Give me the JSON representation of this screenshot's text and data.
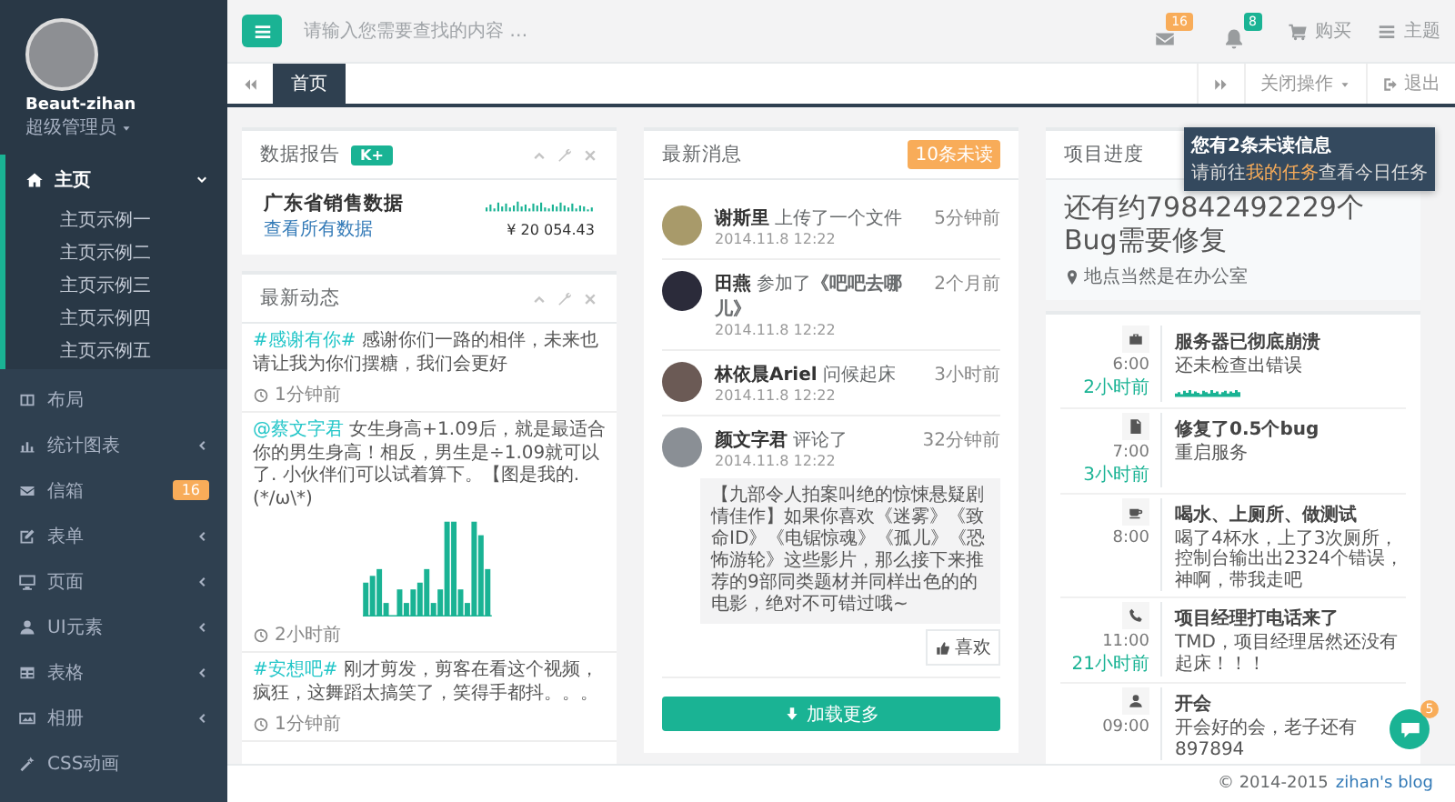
{
  "sidebar": {
    "profile": {
      "name": "Beaut-zihan",
      "role": "超级管理员"
    },
    "menu": [
      {
        "label": "主页",
        "selected": true,
        "expanded": true,
        "children": [
          {
            "label": "主页示例一"
          },
          {
            "label": "主页示例二"
          },
          {
            "label": "主页示例三"
          },
          {
            "label": "主页示例四"
          },
          {
            "label": "主页示例五"
          }
        ]
      },
      {
        "label": "布局",
        "selected": false
      },
      {
        "label": "统计图表",
        "selected": false,
        "expanded": false
      },
      {
        "label": "信箱",
        "selected": false,
        "badge": "16"
      },
      {
        "label": "表单",
        "selected": false,
        "expanded": false
      },
      {
        "label": "页面",
        "selected": false,
        "expanded": false
      },
      {
        "label": "UI元素",
        "selected": false,
        "expanded": false
      },
      {
        "label": "表格",
        "selected": false,
        "expanded": false
      },
      {
        "label": "相册",
        "selected": false,
        "expanded": false
      },
      {
        "label": "CSS动画",
        "selected": false
      }
    ]
  },
  "topbar": {
    "search": {
      "placeholder": "请输入您需要查找的内容 …"
    },
    "notifications": [
      {
        "badge": "16",
        "color": "#f8ac59"
      },
      {
        "badge": "8",
        "color": "#1ab394"
      }
    ],
    "links": [
      {
        "label": "购买"
      },
      {
        "label": "主题"
      }
    ]
  },
  "tabbar": {
    "tabs": [
      {
        "label": "首页",
        "selected": true
      }
    ],
    "close_menu": "关闭操作",
    "logout": "退出"
  },
  "data_report": {
    "title": "数据报告",
    "label": "K+",
    "heading": "广东省销售数据",
    "link": "查看所有数据",
    "amount": "¥ 20 054.43"
  },
  "feed": {
    "title": "最新动态",
    "posts": [
      {
        "kind": "text",
        "tag": "#感谢有你#",
        "text": "感谢你们一路的相伴，未来也请让我为你们摆糖，我们会更好",
        "time": "1分钟前"
      },
      {
        "kind": "chart",
        "tag": "@蔡文字君",
        "text": "女生身高+1.09后，就是最适合你的男生身高！相反，男生是÷1.09就可以了. 小伙伴们可以试着算下。【图是我的. (*/ω\\*)",
        "time": "2小时前"
      },
      {
        "kind": "text",
        "tag": "#安想吧#",
        "text": "刚才剪发，剪客在看这个视频，疯狂，这舞蹈太搞笑了，笑得手都抖。。。",
        "time": "1分钟前"
      }
    ]
  },
  "messages": {
    "title": "最新消息",
    "badge": "10条未读",
    "items": [
      {
        "name": "谢斯里",
        "action": "上传了一个文件",
        "date": "2014.11.8 12:22",
        "ago": "5分钟前"
      },
      {
        "name": "田燕",
        "action": "参加了**《吧吧去哪儿》**",
        "date": "2014.11.8 12:22",
        "ago": "2个月前"
      },
      {
        "name": "林依晨Ariel",
        "action": "问候起床",
        "date": "2014.11.8 12:22",
        "ago": "3小时前"
      },
      {
        "name": "颜文字君",
        "action": "评论了",
        "date": "2014.11.8 12:22",
        "ago": "32分钟前",
        "quote": "【九部令人拍案叫绝的惊悚悬疑剧情佳作】如果你喜欢《迷雾》《致命ID》《电锯惊魂》《孤儿》《恐怖游轮》这些影片，那么接下来推荐的9部同类题材并同样出色的的电影，绝对不可错过哦~",
        "like": "喜欢"
      }
    ],
    "load_more": "加载更多"
  },
  "project": {
    "title": "项目进度",
    "headline": "还有约79842492229个Bug需要修复",
    "location": "地点当然是在办公室",
    "timeline": [
      {
        "kind": "chart",
        "time": "6:00",
        "ago": "2小时前",
        "title": "服务器已彻底崩溃",
        "text": "还未检查出错误"
      },
      {
        "kind": "text",
        "time": "7:00",
        "ago": "3小时前",
        "title": "修复了0.5个bug",
        "text": "重启服务"
      },
      {
        "kind": "text",
        "time": "8:00",
        "title": "喝水、上厕所、做测试",
        "text": "喝了4杯水，上了3次厕所，控制台输出出2324个错误，神啊，带我走吧"
      },
      {
        "kind": "text",
        "time": "11:00",
        "ago": "21小时前",
        "title": "项目经理打电话来了",
        "text": "TMD，项目经理居然还没有起床！！！"
      },
      {
        "kind": "text",
        "time": "09:00",
        "title": "开会",
        "text": "开会好的会，老子还有897894"
      }
    ]
  },
  "popup": {
    "title": "您有2条未读信息",
    "before": "请前往",
    "link": "我的任务",
    "after": "查看今日任务"
  },
  "chat_button": {
    "badge": "5"
  },
  "footer": {
    "copyright": "© 2014-2015",
    "link": "zihan's blog"
  }
}
